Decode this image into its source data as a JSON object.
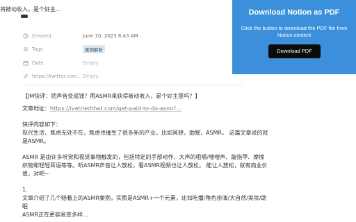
{
  "page": {
    "title_fragment": "将被动收入，是个好主…"
  },
  "properties": [
    {
      "icon": "clock-icon",
      "name": "Created",
      "value": "June 10, 2023 8:43 AM",
      "empty": false
    },
    {
      "icon": "list-icon",
      "name": "Tags",
      "tag": "案例解析"
    },
    {
      "icon": "calendar-icon",
      "name": "Date",
      "value": "Empty",
      "empty": true
    },
    {
      "icon": "link-icon",
      "name": "https://twitter.com…",
      "value": "Empty",
      "empty": true
    }
  ],
  "content": {
    "quote": "【JM快评：把声音变成钱？用ASMR来获得被动收入，是个好主意吗？】",
    "article_label": "文章地址：",
    "article_link": "https://ivetriedthat.com/get-paid-to-do-asmr/…",
    "summary_heading": "快评内容如下：",
    "para1_line1": "现代生活，焦虑无处不在，焦虑也催生了很多新的产业，比如冥想，助眠，ASMR， 这篇文章说的就",
    "para1_line2": "是ASMR。",
    "para2_line1": "ASMR 是由许多听觉和视觉事物触发的，包括特定的手部动作、大声的咀嚼/嗖嗖声、敲指甲、摩擦",
    "para2_line2": "织物和轻轻耳语等等。听ASMR声音让人放松，看ASMR视频也让人放松。 能让人放松，就有商业价",
    "para2_line3": "值，对吧~",
    "item1_number": "1.",
    "item1_line1": "文章介绍了几个赔着上的ASMR案例，实质是ASMR+一个元素，比如吃播/角色扮演/大自然/美妆/助",
    "item1_line2": "眠",
    "item1_line3": "ASMR正在更容易变多样…"
  },
  "popup": {
    "title": "Download Notion as PDF",
    "description": "Click the button to download the PDF file from Notion content",
    "button_label": "Download PDF",
    "background": "#3b8fdb",
    "button_color": "#0b0b0b"
  }
}
